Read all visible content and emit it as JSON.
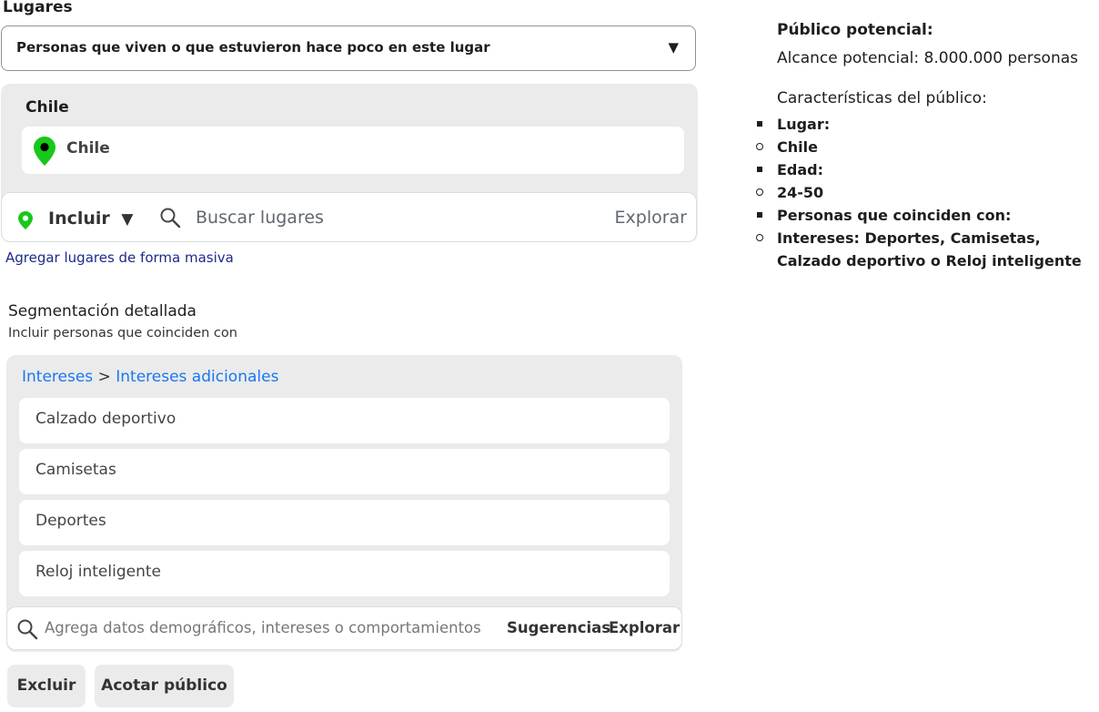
{
  "places": {
    "title": "Lugares",
    "dropdown_value": "Personas que viven o que estuvieron hace poco en este lugar",
    "dropdown_arrow": "▼",
    "country_label": "Chile",
    "selected_location": "Chile",
    "include_label": "Incluir",
    "include_arrow": "▼",
    "search_placeholder": "Buscar lugares",
    "explore_label": "Explorar",
    "bulk_link": "Agregar lugares de forma masiva",
    "pin_color": "#17c81b"
  },
  "segmentation": {
    "title": "Segmentación detallada",
    "subtitle": "Incluir personas que coinciden con",
    "breadcrumb": {
      "root": "Intereses",
      "separator": ">",
      "child": "Intereses adicionales"
    },
    "interests": [
      "Calzado deportivo",
      "Camisetas",
      "Deportes",
      "Reloj inteligente"
    ],
    "search_placeholder": "Agrega datos demográficos, intereses o comportamientos",
    "suggestions_label": "Sugerencias",
    "explore_label": "Explorar"
  },
  "actions": {
    "exclude_label": "Excluir",
    "narrow_label": "Acotar público"
  },
  "audience": {
    "title": "Público potencial:",
    "reach": "Alcance potencial: 8.000.000 personas",
    "characteristics_title": "Características del público:",
    "items": [
      "Lugar:",
      "Chile",
      "Edad:",
      "24-50",
      "Personas que coinciden con:",
      "Intereses: Deportes, Camisetas, Calzado deportivo o Reloj inteligente"
    ]
  },
  "colors": {
    "link_blue": "#1877f2",
    "panel_gray": "#ebebeb",
    "bulk_link": "#1d2a8c"
  }
}
